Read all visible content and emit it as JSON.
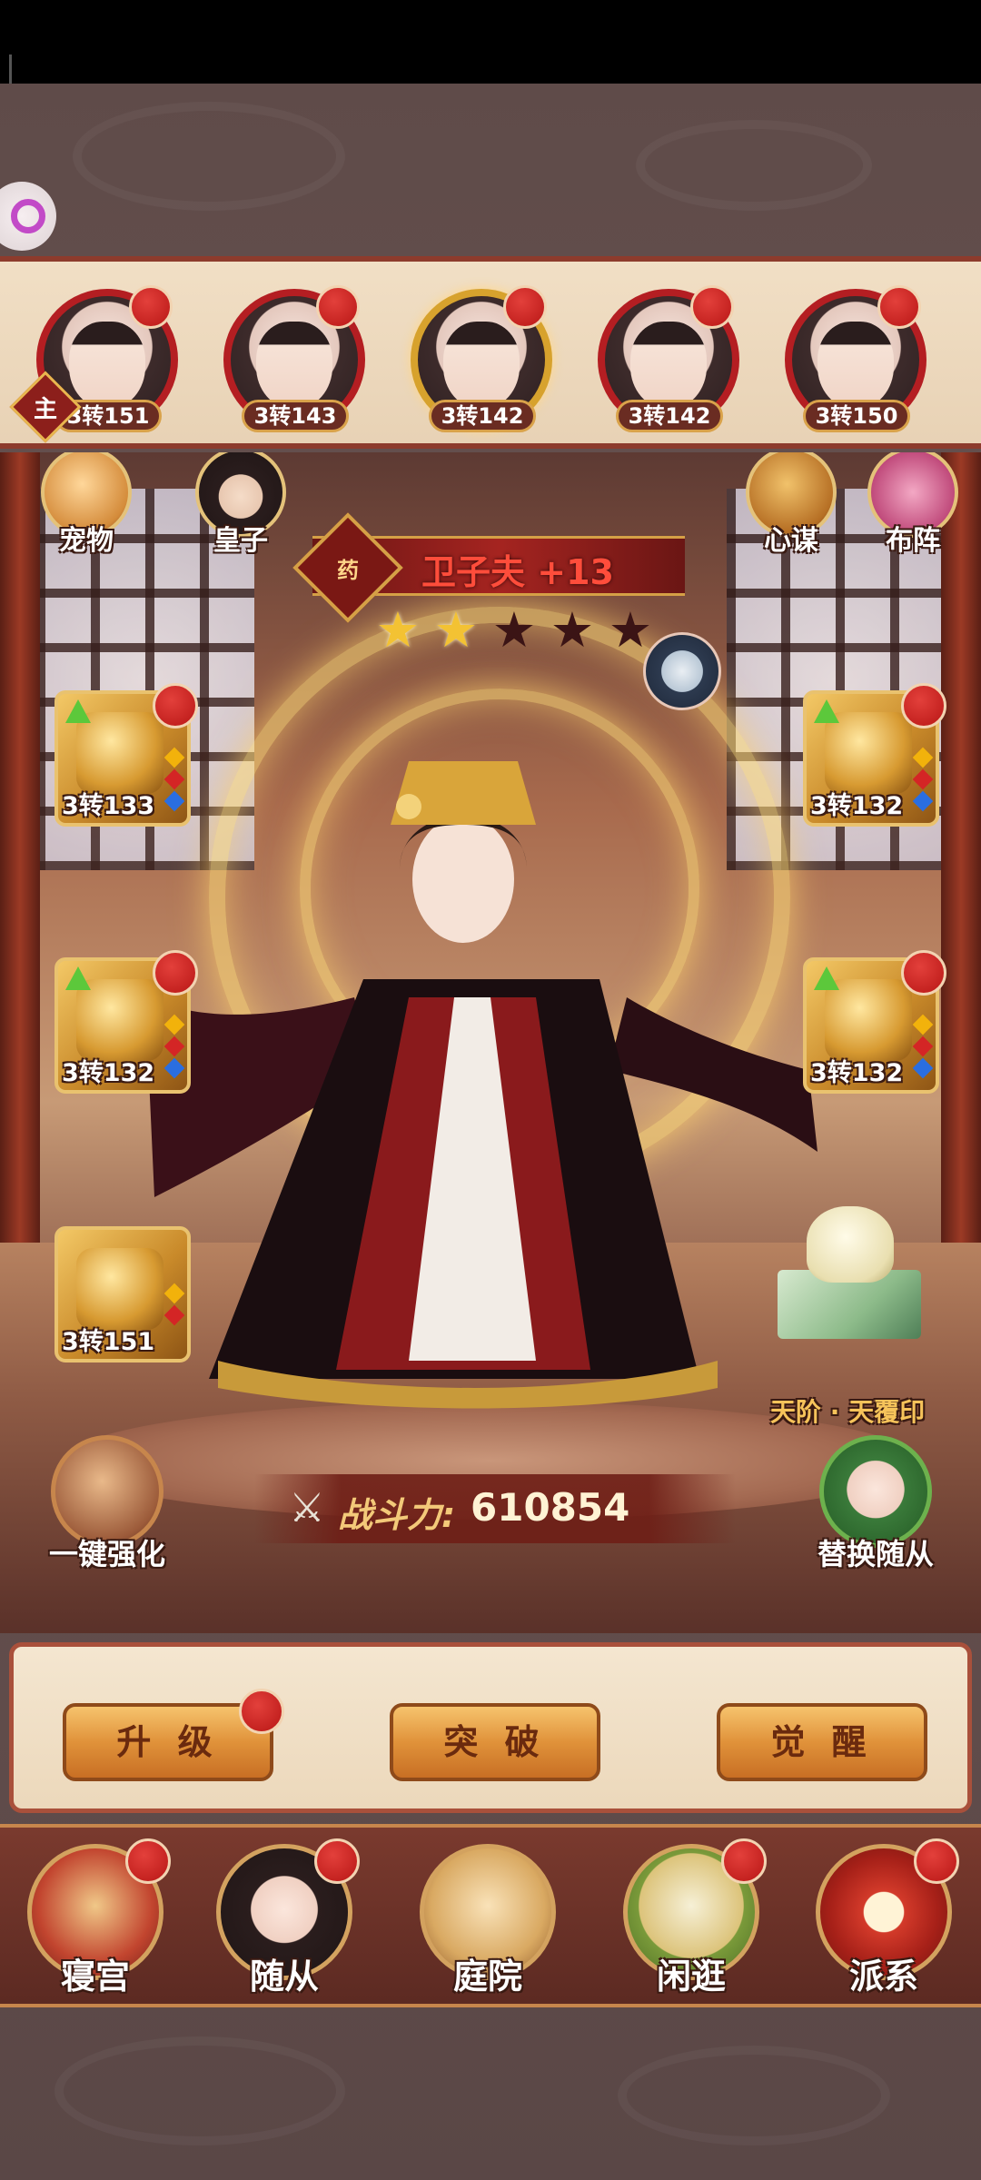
{
  "roster": [
    {
      "level": "3转151",
      "is_master": true,
      "master_label": "主",
      "selected": false
    },
    {
      "level": "3转143",
      "selected": false
    },
    {
      "level": "3转142",
      "selected": true
    },
    {
      "level": "3转142",
      "selected": false
    },
    {
      "level": "3转150",
      "selected": false
    }
  ],
  "top_left_icons": [
    {
      "label": "宠物"
    },
    {
      "label": "皇子"
    }
  ],
  "top_right_icons": [
    {
      "label": "心谋"
    },
    {
      "label": "布阵"
    }
  ],
  "character": {
    "badge": "药",
    "name": "卫子夫 +13",
    "stars_total": 5,
    "stars_filled": 2
  },
  "equipment": {
    "left": [
      {
        "level": "3转133"
      },
      {
        "level": "3转132"
      },
      {
        "level": "3转151"
      }
    ],
    "right": [
      {
        "level": "3转132"
      },
      {
        "level": "3转132"
      }
    ]
  },
  "seal": {
    "label": "天阶 · 天覆印"
  },
  "one_key_enhance": {
    "label": "一键强化"
  },
  "replace_follower": {
    "label": "替换随从"
  },
  "power": {
    "label": "战斗力:",
    "value": "610854"
  },
  "actions": {
    "upgrade": "升 级",
    "breakthrough": "突 破",
    "awaken": "觉 醒"
  },
  "bottom_nav": [
    {
      "label": "寝宫"
    },
    {
      "label": "随从"
    },
    {
      "label": "庭院"
    },
    {
      "label": "闲逛"
    },
    {
      "label": "派系"
    }
  ],
  "icons": [
    "search-icon",
    "pet-icon",
    "prince-icon",
    "strategy-icon",
    "formation-icon",
    "sword-icon",
    "star-icon",
    "red-dot-icon"
  ],
  "colors": {
    "accent": "#b41e22",
    "gold": "#d5a046",
    "name_red": "#ff4d3b",
    "panel": "#f4e6d0"
  }
}
